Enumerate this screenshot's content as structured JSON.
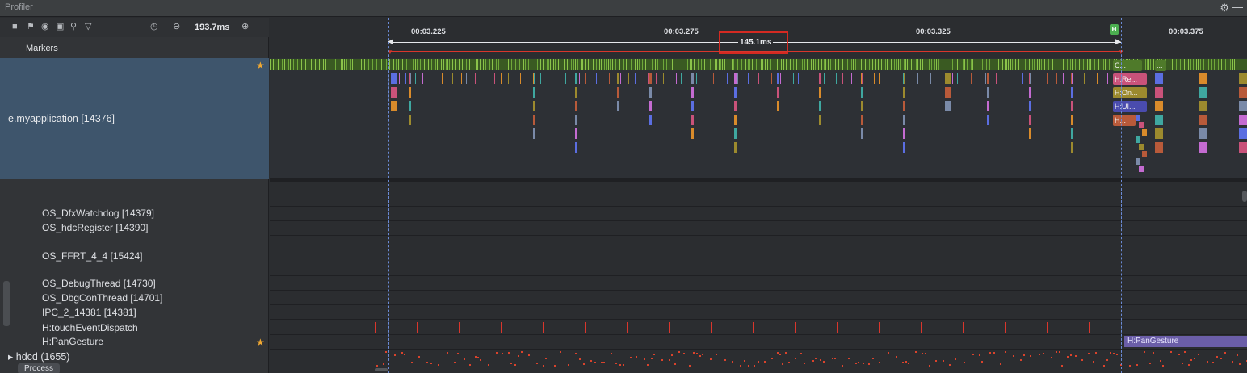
{
  "window": {
    "title": "Profiler"
  },
  "toolbar": {
    "zoom_value": "193.7ms",
    "icons": [
      "stop-icon",
      "flag-icon",
      "record-icon",
      "screenshot-icon",
      "search-icon",
      "filter-icon",
      "clock-icon",
      "zoom-out-icon",
      "zoom-in-icon"
    ]
  },
  "markers_label": "Markers",
  "ruler": {
    "ticks": [
      "00:03.225",
      "00:03.275",
      "00:03.325",
      "00:03.375"
    ],
    "selection_duration": "145.1ms",
    "flag_glyph": "H"
  },
  "process": {
    "name": "e.myapplication [14376]"
  },
  "threads": [
    "OS_DfxWatchdog [14379]",
    "OS_hdcRegister [14390]",
    "OS_FFRT_4_4 [15424]",
    "OS_DebugThread [14730]",
    "OS_DbgConThread [14701]",
    "IPC_2_14381 [14381]",
    "H:touchEventDispatch",
    "H:PanGesture"
  ],
  "hdcd": {
    "name": "hdcd (1655)",
    "badge": "Process"
  },
  "events": {
    "c_label": "C...",
    "dots": "...",
    "re": "H:Re...",
    "on": "H:On...",
    "ui": "H:UI...",
    "h": "H...",
    "pan": "H:PanGesture"
  },
  "colors": {
    "accent_red": "#d42a22",
    "process_row": "#3e556c",
    "pan_gesture": "#6b5ea8",
    "selection_line": "#6b8bd6"
  }
}
